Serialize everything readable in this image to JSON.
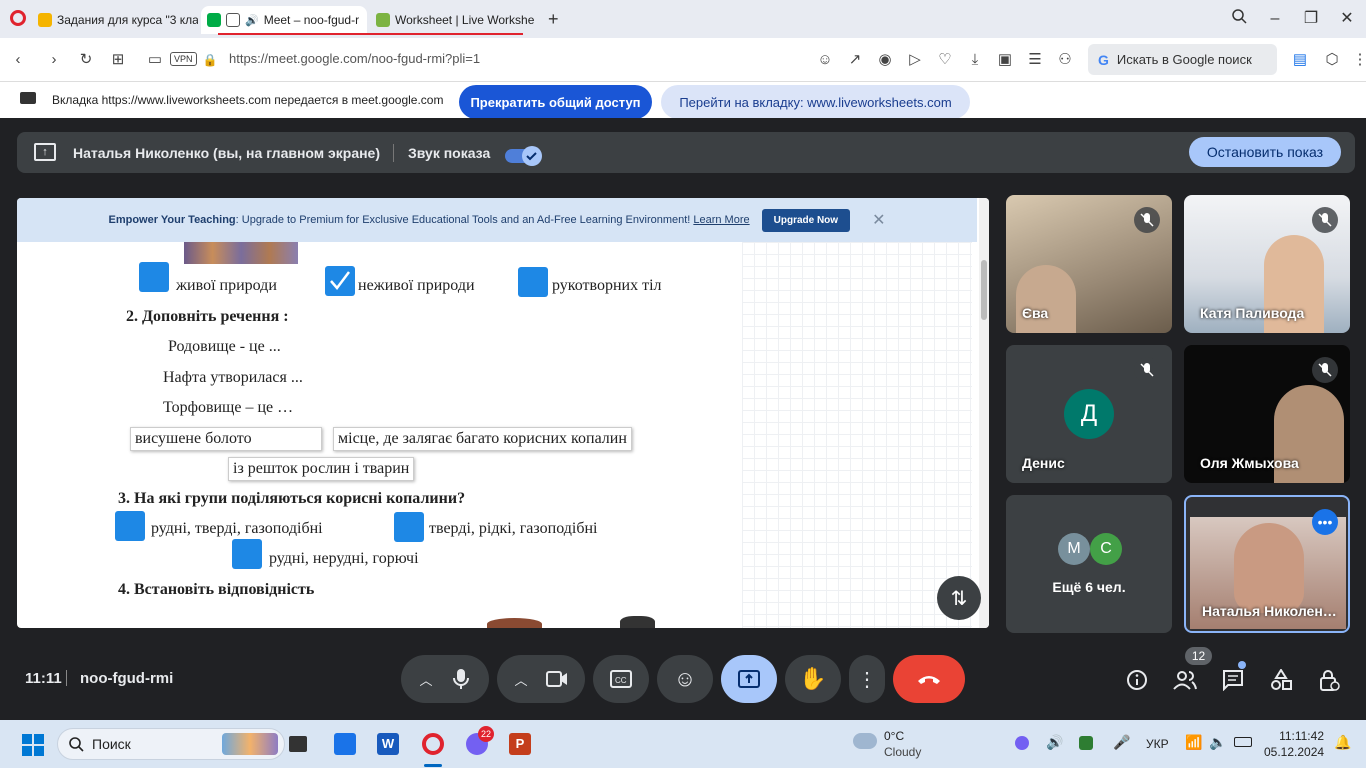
{
  "browser": {
    "tabs": [
      {
        "title": "Задания для курса \"3 кла"
      },
      {
        "title": "Meet – noo-fgud-r"
      },
      {
        "title": "Worksheet | Live Workshe"
      }
    ],
    "url": "https://meet.google.com/noo-fgud-rmi?pli=1",
    "vpn": "VPN",
    "search_placeholder": "Искать в Google поиск"
  },
  "share_notice": {
    "message": "Вкладка https://www.liveworksheets.com передается в meet.google.com",
    "stop_label": "Прекратить общий доступ",
    "goto_label": "Перейти на вкладку: www.liveworksheets.com"
  },
  "presentation": {
    "presenter": "Наталья Николенко (вы, на главном экране)",
    "sound_label": "Звук показа",
    "sound_enabled": true,
    "stop_label": "Остановить показ"
  },
  "worksheet": {
    "banner_strong": "Empower Your Teaching",
    "banner_text": ": Upgrade to Premium for Exclusive Educational Tools and an Ad-Free Learning Environment!",
    "banner_link": "Learn More",
    "banner_button": "Upgrade Now",
    "q1_options": [
      "живої природи",
      "неживої природи",
      "рукотворних тіл"
    ],
    "q2_title": "2. Доповніть речення :",
    "q2_lines": [
      "Родовище - це ...",
      "Нафта утворилася ...",
      "Торфовище – це …"
    ],
    "q2_answers": [
      "висушене болото",
      "місце, де залягає багато корисних копалин",
      "із решток рослин і тварин"
    ],
    "q3_title": "3. На які групи поділяються корисні копалини?",
    "q3_options": [
      "рудні, тверді, газоподібні",
      "тверді, рідкі, газоподібні",
      "рудні, нерудні, горючі"
    ],
    "q4_title": "4. Встановіть відповідність"
  },
  "participants": [
    {
      "name": "Єва",
      "muted": true
    },
    {
      "name": "Катя Паливода",
      "muted": true
    },
    {
      "name": "Денис",
      "initial": "Д",
      "muted": true,
      "color": "#00796b"
    },
    {
      "name": "Оля Жмыхова",
      "muted": true
    },
    {
      "name": "Ещё 6 чел.",
      "initials": [
        "М",
        "С"
      ]
    },
    {
      "name": "Наталья Николен…"
    }
  ],
  "meeting": {
    "time": "11:11",
    "code": "noo-fgud-rmi",
    "people_count": "12"
  },
  "taskbar": {
    "search_label": "Поиск",
    "opera_badge": "22",
    "weather_temp": "0°C",
    "weather_desc": "Cloudy",
    "lang": "УКР",
    "time": "11:11:42",
    "date": "05.12.2024"
  },
  "colors": {
    "meet_bg": "#202124",
    "end_call": "#ea4335",
    "accent_blue": "#a8c7fa",
    "checkbox_blue": "#1e88e5"
  }
}
